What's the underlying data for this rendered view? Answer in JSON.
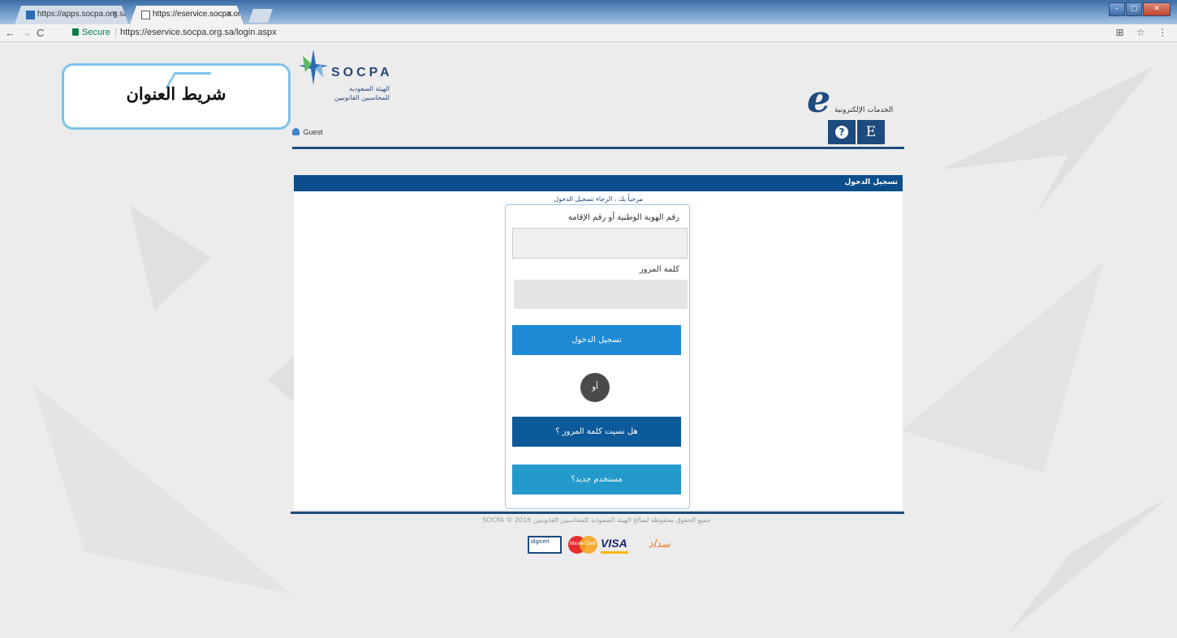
{
  "browser": {
    "tabs": [
      {
        "title": "https://apps.socpa.org.sa",
        "close": "×"
      },
      {
        "title": "https://eservice.socpa.org",
        "close": "×"
      }
    ],
    "security_label": "Secure",
    "separator": "|",
    "url": "https://eservice.socpa.org.sa/login.aspx",
    "nav": {
      "back": "←",
      "forward": "→",
      "reload": "C"
    },
    "toolbar_icons": "⊞ ☆ ⋮",
    "window_buttons": {
      "minimize": "–",
      "maximize": "▢",
      "close": "✕"
    }
  },
  "header": {
    "logo_name": "SOCPA",
    "logo_arabic_line1": "الهيئة السعودية",
    "logo_arabic_line2": "للمحاسبين القانونيين",
    "guest_label": "Guest",
    "eservices_label": "الخدمات الإلكترونية",
    "eservices_mark": "e",
    "help_button": "?",
    "language_button": "E"
  },
  "annotation": {
    "text": "شريط العنوان"
  },
  "login": {
    "section_title": "تسجيل الدخول",
    "welcome_text": "مرحباً بك ، الرجاء تسجيل الدخول",
    "id_label": "رقم الهوية الوطنية أو رقم الإقامة",
    "id_value": "",
    "password_label": "كلمة المرور",
    "password_value": "",
    "login_button": "تسجيل الدخول",
    "or_label": "أو",
    "forgot_button": "هل نسيت كلمة المرور ؟",
    "new_user_button": "مستخدم جديد؟"
  },
  "footer": {
    "copyright": "جميع الحقوق محفوظة لصالح الهيئة السعودية للمحاسبين القانونيين 2016 © SOCPA",
    "payments": {
      "digicert": "digicert",
      "mastercard": "MasterCard",
      "visa": "VISA",
      "sadad": "سداد"
    }
  },
  "colors": {
    "primary": "#1d4b7e",
    "card_header": "#0c4d8c",
    "login_button": "#1e8ad6",
    "forgot_button": "#0c5a9a",
    "new_user_button": "#239acb",
    "annotation_border": "#7cc3ec"
  }
}
